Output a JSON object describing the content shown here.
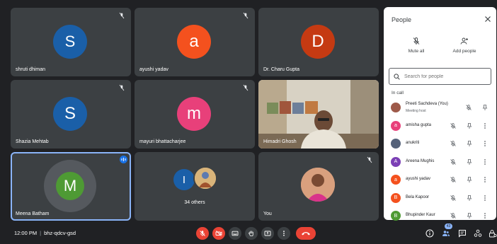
{
  "tiles": [
    {
      "name": "shruti dhiman",
      "initial": "S",
      "color": "#1a5fa8"
    },
    {
      "name": "ayushi yadav",
      "initial": "a",
      "color": "#f4511e"
    },
    {
      "name": "Dr. Charu Gupta",
      "initial": "D",
      "color": "#c53a12"
    },
    {
      "name": "Shazia Mehtab",
      "initial": "S",
      "color": "#1a5fa8"
    },
    {
      "name": "mayuri bhattacharjee",
      "initial": "m",
      "color": "#e8407a"
    },
    {
      "name": "Himadri Ghosh"
    },
    {
      "name": "Meena Batham",
      "initial": "M",
      "color": "#4e9a34"
    },
    {
      "name": "34 others",
      "initial": "I",
      "color": "#1a5fa8"
    },
    {
      "name": "You"
    }
  ],
  "panel": {
    "title": "People",
    "mute_all": "Mute all",
    "add_people": "Add people",
    "search_placeholder": "Search for people",
    "in_call": "In call",
    "participants": [
      {
        "name": "Preeti Sachdeva (You)",
        "sub": "Meeting host",
        "initial": "",
        "color": "#9e5a4a"
      },
      {
        "name": "amisha gupta",
        "initial": "a",
        "color": "#e8407a"
      },
      {
        "name": "anukriti",
        "initial": "",
        "color": "#55627a"
      },
      {
        "name": "Areena Mughis",
        "initial": "A",
        "color": "#7b3fb5"
      },
      {
        "name": "ayushi yadav",
        "initial": "a",
        "color": "#f4511e"
      },
      {
        "name": "Bela Kapoor",
        "initial": "B",
        "color": "#f4511e"
      },
      {
        "name": "Bhupinder Kaur",
        "initial": "B",
        "color": "#4e9a34"
      }
    ]
  },
  "bottom": {
    "time": "12:00 PM",
    "meeting_code": "bhz-qdcv-gsd",
    "people_count": "43"
  }
}
